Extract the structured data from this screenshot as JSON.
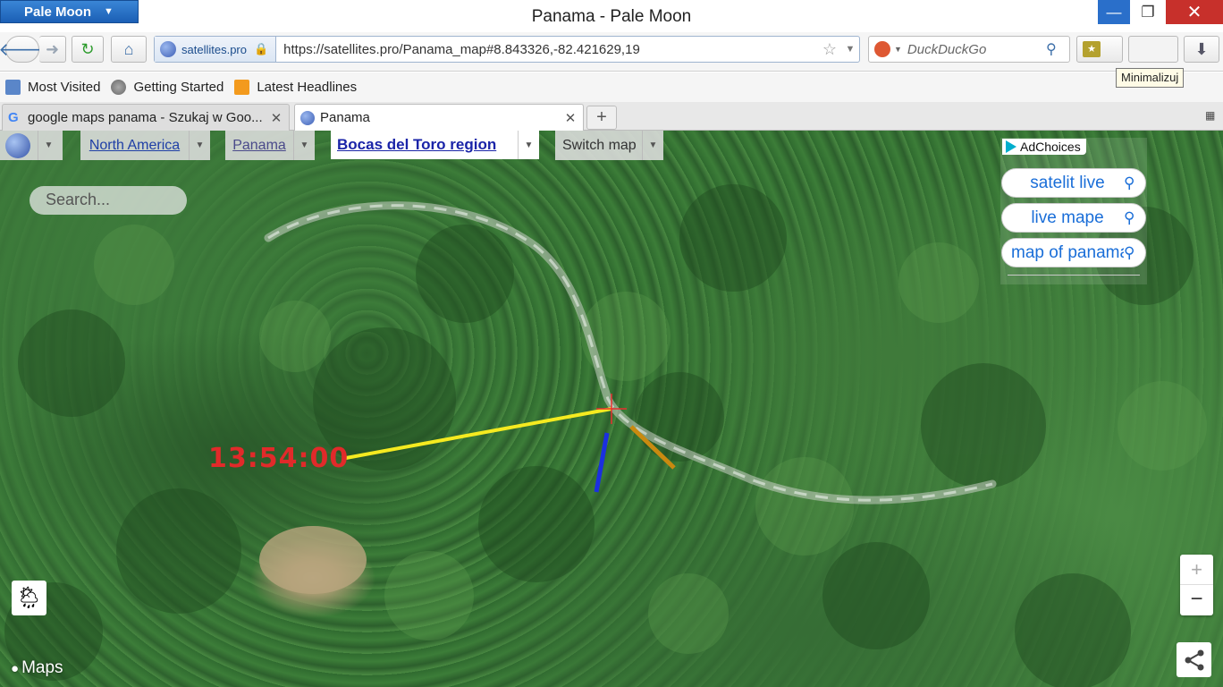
{
  "window": {
    "app_button": "Pale Moon",
    "title": "Panama - Pale Moon",
    "min_label": "—",
    "max_label": "❐",
    "close_label": "✕",
    "tooltip": "Minimalizuj"
  },
  "navbar": {
    "site_identity": "satellites.pro",
    "url": "https://satellites.pro/Panama_map#8.843326,-82.421629,19",
    "search_engine": "DuckDuckGo"
  },
  "bookmarks": [
    {
      "label": "Most Visited"
    },
    {
      "label": "Getting Started"
    },
    {
      "label": "Latest Headlines"
    }
  ],
  "tabs": [
    {
      "label": "google maps panama - Szukaj w Goo...",
      "favicon": "G",
      "active": false
    },
    {
      "label": "Panama",
      "active": true
    }
  ],
  "map": {
    "breadcrumbs": {
      "continent": "North America",
      "country": "Panama",
      "region": "Bocas del Toro region",
      "switch": "Switch map"
    },
    "search_placeholder": "Search...",
    "ads": {
      "adchoices": "AdChoices",
      "items": [
        {
          "label": "satelit live"
        },
        {
          "label": "live mape"
        },
        {
          "label": "map of panama"
        }
      ]
    },
    "time": "13:54:00",
    "attribution": "Maps",
    "zoom_in": "+",
    "zoom_out": "−",
    "colors": {
      "sun_line": "#f5ea20",
      "sunrise_line": "#1b2fe0",
      "sunset_line": "#c98a10",
      "crosshair": "#e83030"
    }
  }
}
